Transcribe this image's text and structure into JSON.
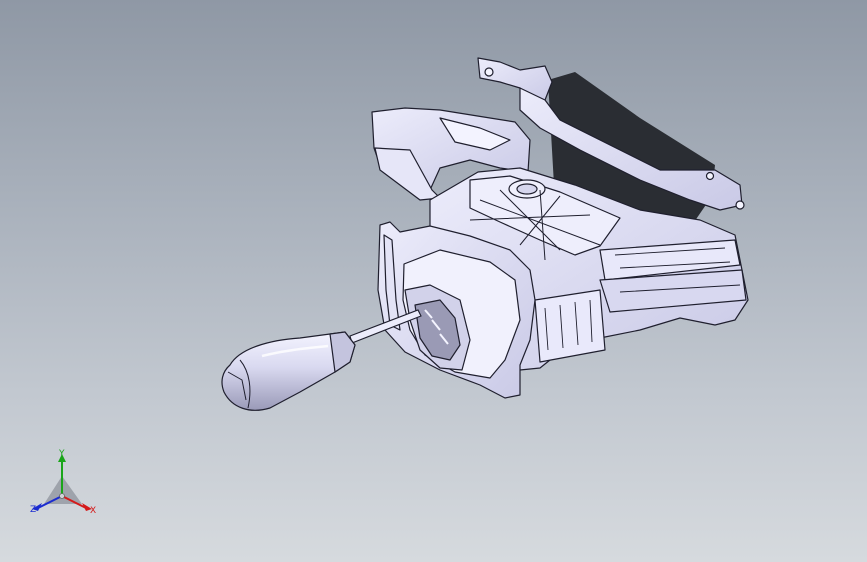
{
  "viewport": {
    "background_top": "#8f98a5",
    "background_bottom": "#d6dade",
    "part_color": "#dcdcf4",
    "edge_color": "#1f1f2e",
    "shadow_color": "#2a2d33"
  },
  "triad": {
    "x_label": "X",
    "y_label": "Y",
    "z_label": "Z",
    "x_color": "#d41a1a",
    "y_color": "#1aa51a",
    "z_color": "#1a2bd0"
  },
  "model": {
    "components": [
      "gear-shift-housing",
      "shift-lever-rod",
      "shift-knob"
    ]
  }
}
